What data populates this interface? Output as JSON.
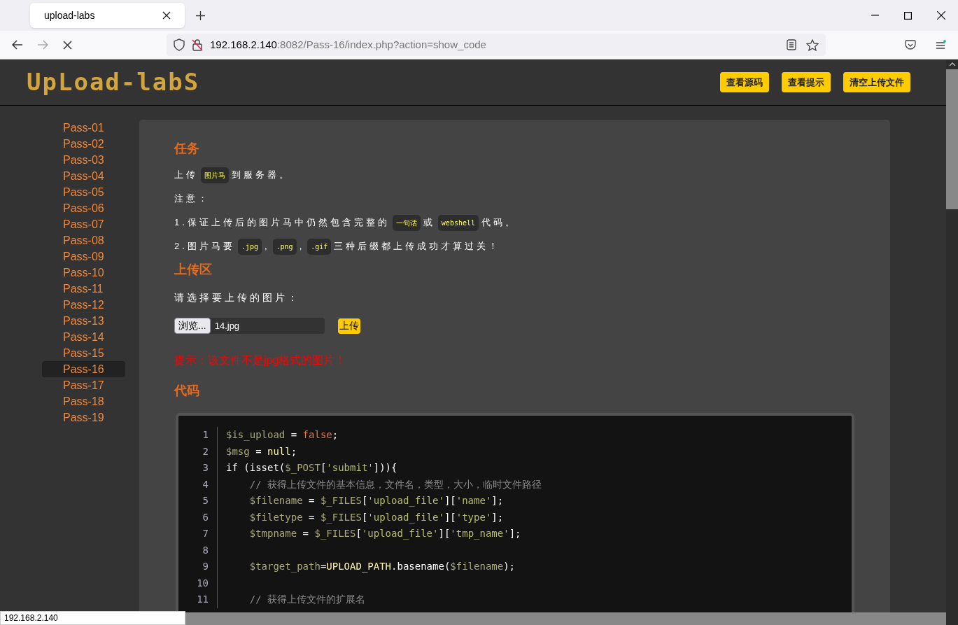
{
  "browser": {
    "tab_title": "upload-labs",
    "url_host": "192.168.2.140",
    "url_rest": ":8082/Pass-16/index.php?action=show_code",
    "status_url": "192.168.2.140"
  },
  "header": {
    "logo": "UpLoad-labS",
    "buttons": [
      "查看源码",
      "查看提示",
      "清空上传文件"
    ]
  },
  "sidebar": {
    "items": [
      {
        "label": "Pass-01",
        "selected": false
      },
      {
        "label": "Pass-02",
        "selected": false
      },
      {
        "label": "Pass-03",
        "selected": false
      },
      {
        "label": "Pass-04",
        "selected": false
      },
      {
        "label": "Pass-05",
        "selected": false
      },
      {
        "label": "Pass-06",
        "selected": false
      },
      {
        "label": "Pass-07",
        "selected": false
      },
      {
        "label": "Pass-08",
        "selected": false
      },
      {
        "label": "Pass-09",
        "selected": false
      },
      {
        "label": "Pass-10",
        "selected": false
      },
      {
        "label": "Pass-11",
        "selected": false
      },
      {
        "label": "Pass-12",
        "selected": false
      },
      {
        "label": "Pass-13",
        "selected": false
      },
      {
        "label": "Pass-14",
        "selected": false
      },
      {
        "label": "Pass-15",
        "selected": false
      },
      {
        "label": "Pass-16",
        "selected": true
      },
      {
        "label": "Pass-17",
        "selected": false
      },
      {
        "label": "Pass-18",
        "selected": false
      },
      {
        "label": "Pass-19",
        "selected": false
      }
    ]
  },
  "task": {
    "heading": "任务",
    "paragraphs": [
      [
        {
          "kind": "text",
          "text": "上传"
        },
        {
          "kind": "code",
          "text": "图片马"
        },
        {
          "kind": "text",
          "text": "到服务器。"
        }
      ],
      [
        {
          "kind": "text",
          "text": "注意："
        }
      ],
      [
        {
          "kind": "text",
          "text": "1.保证上传后的图片马中仍然包含完整的"
        },
        {
          "kind": "code",
          "text": "一句话"
        },
        {
          "kind": "text",
          "text": "或"
        },
        {
          "kind": "code",
          "text": "webshell"
        },
        {
          "kind": "text",
          "text": "代码。"
        }
      ],
      [
        {
          "kind": "text",
          "text": "2.图片马要"
        },
        {
          "kind": "code",
          "text": ".jpg"
        },
        {
          "kind": "text",
          "text": ","
        },
        {
          "kind": "code",
          "text": ".png"
        },
        {
          "kind": "text",
          "text": ","
        },
        {
          "kind": "code",
          "text": ".gif"
        },
        {
          "kind": "text",
          "text": "三种后缀都上传成功才算过关！"
        }
      ]
    ]
  },
  "upload": {
    "heading": "上传区",
    "prompt": "请选择要上传的图片：",
    "browse_button": "浏览...",
    "file_name": "14.jpg",
    "submit_button": "上传",
    "message": "提示：该文件不是jpg格式的图片！"
  },
  "code": {
    "heading": "代码",
    "lines": [
      {
        "number": "1",
        "text": "$is_upload = false;"
      },
      {
        "number": "2",
        "text": "$msg = null;"
      },
      {
        "number": "3",
        "text": "if (isset($_POST['submit'])){"
      },
      {
        "number": "4",
        "text": "    // 获得上传文件的基本信息，文件名，类型，大小，临时文件路径"
      },
      {
        "number": "5",
        "text": "    $filename = $_FILES['upload_file']['name'];"
      },
      {
        "number": "6",
        "text": "    $filetype = $_FILES['upload_file']['type'];"
      },
      {
        "number": "7",
        "text": "    $tmpname = $_FILES['upload_file']['tmp_name'];"
      },
      {
        "number": "8"
      },
      {
        "number": "9",
        "text": "    $target_path=UPLOAD_PATH.basename($filename);"
      },
      {
        "number": "10"
      },
      {
        "number": "11",
        "text": "    // 获得上传文件的扩展名"
      }
    ]
  }
}
